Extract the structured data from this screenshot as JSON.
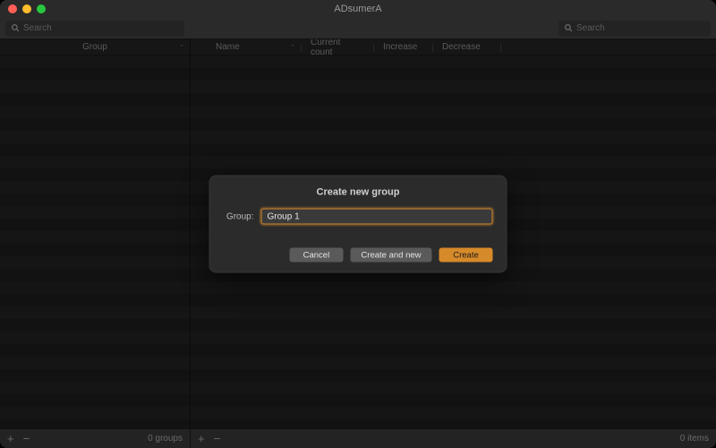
{
  "window": {
    "title": "ADsumerA"
  },
  "search": {
    "sidebar_placeholder": "Search",
    "main_placeholder": "Search"
  },
  "sidebar": {
    "column": "Group"
  },
  "columns": {
    "name": "Name",
    "current_count": "Current count",
    "increase": "Increase",
    "decrease": "Decrease"
  },
  "footer": {
    "groups_count": "0 groups",
    "items_count": "0 items",
    "plus": "+",
    "minus": "−"
  },
  "modal": {
    "title": "Create new group",
    "field_label": "Group:",
    "field_value": "Group 1",
    "cancel": "Cancel",
    "create_and_new": "Create and new",
    "create": "Create"
  },
  "colors": {
    "accent": "#d78a2a"
  }
}
